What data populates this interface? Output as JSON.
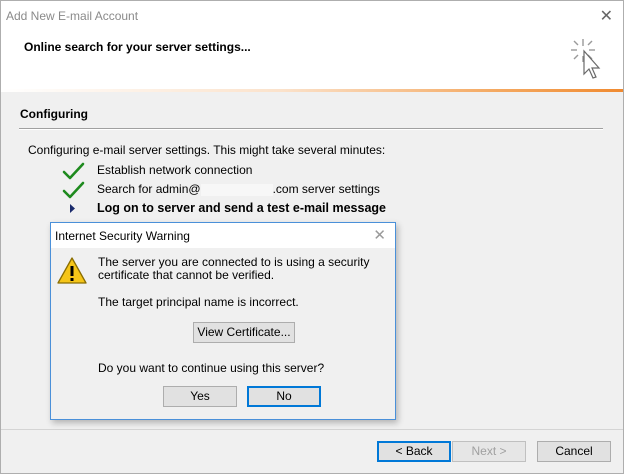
{
  "window": {
    "title": "Add New E-mail Account",
    "close_glyph": "✕",
    "heading": "Online search for your server settings..."
  },
  "section": {
    "title": "Configuring",
    "intro": "Configuring e-mail server settings. This might take several minutes:"
  },
  "steps": [
    {
      "status": "done",
      "icon": "check-icon",
      "label": "Establish network connection"
    },
    {
      "status": "done",
      "icon": "check-icon",
      "label_prefix": "Search for admin@",
      "label_suffix": ".com server settings"
    },
    {
      "status": "current",
      "icon": "arrow-right-icon",
      "label": "Log on to server and send a test e-mail message"
    }
  ],
  "footer": {
    "back_label": "< Back",
    "next_label": "Next >",
    "cancel_label": "Cancel"
  },
  "dialog": {
    "title": "Internet Security Warning",
    "close_glyph": "✕",
    "message": "The server you are connected to is using a security certificate that cannot be verified.",
    "detail": "The target principal name is incorrect.",
    "view_certificate_label": "View Certificate...",
    "question": "Do you want to continue using this server?",
    "yes_label": "Yes",
    "no_label": "No"
  },
  "colors": {
    "check": "#1e8a1e",
    "arrow": "#1a2a6c",
    "accent": "#f08a30",
    "focus_border": "#0078d7"
  }
}
